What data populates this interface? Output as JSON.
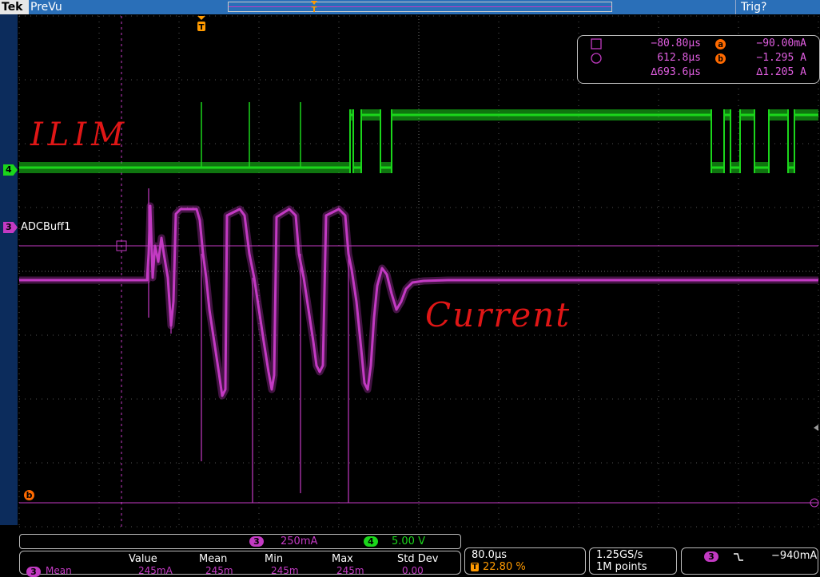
{
  "header": {
    "brand": "Tek",
    "mode": "PreVu",
    "trigger_status": "Trig?"
  },
  "colors": {
    "ch3": "#c33ac3",
    "ch4": "#1bd61b",
    "cursor": "#ff6a00",
    "annotation": "#e01616",
    "grid": "#7a7a7a"
  },
  "cursor_readout": {
    "row1": {
      "time": "−80.80µs",
      "badge": "a",
      "value": "−90.00mA"
    },
    "row2": {
      "time": "612.8µs",
      "badge": "b",
      "value": "−1.295 A"
    },
    "row3": {
      "time": "∆693.6µs",
      "value": "∆1.205 A"
    }
  },
  "channels": {
    "ch3": {
      "number": "3",
      "label": "ADCBuff1",
      "scale": "250mA"
    },
    "ch4": {
      "number": "4",
      "scale": "5.00 V"
    }
  },
  "annotations": {
    "left": "ILIM",
    "right": "Current"
  },
  "markers": {
    "trigger": "T",
    "cursor_b": "b"
  },
  "measurements": {
    "headers": [
      "Value",
      "Mean",
      "Min",
      "Max",
      "Std Dev"
    ],
    "row": {
      "source": "3",
      "name": "Mean",
      "value": "245mA",
      "mean": "245m",
      "min": "245m",
      "max": "245m",
      "std": "0.00"
    }
  },
  "horizontal": {
    "time_per_div": "80.0µs",
    "trigger_position": "22.80 %"
  },
  "acquisition": {
    "sample_rate": "1.25GS/s",
    "record_length": "1M points"
  },
  "trigger": {
    "source": "3",
    "slope_icon": "falling-edge-icon",
    "slope": "⿼",
    "level": "−940mA"
  }
}
